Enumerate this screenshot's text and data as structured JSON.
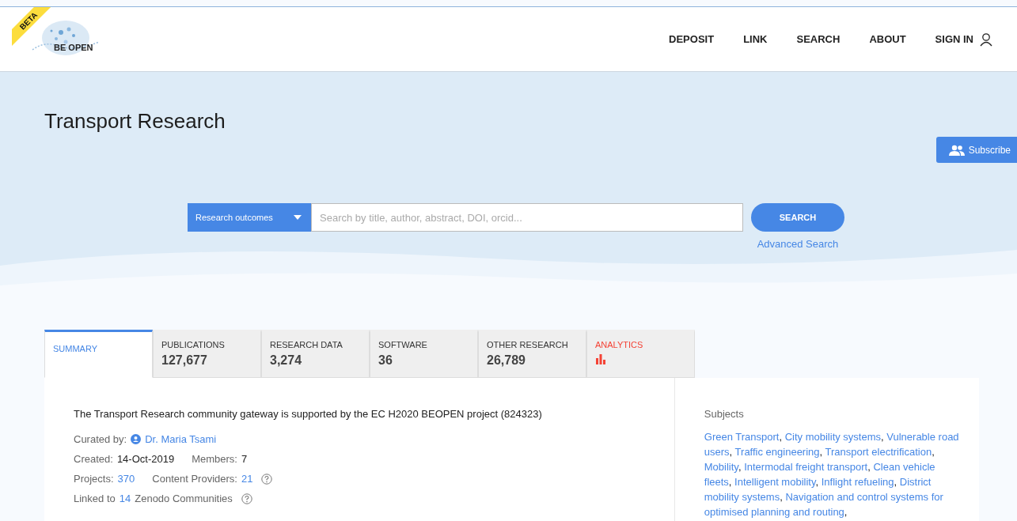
{
  "header": {
    "badge": "BETA",
    "logo_text": "BE OPEN",
    "nav": [
      {
        "label": "DEPOSIT"
      },
      {
        "label": "LINK"
      },
      {
        "label": "SEARCH"
      },
      {
        "label": "ABOUT"
      },
      {
        "label": "SIGN IN",
        "kind": "account"
      }
    ]
  },
  "hero": {
    "title": "Transport Research",
    "subscribe": "Subscribe",
    "search": {
      "dropdown": "Research outcomes",
      "placeholder": "Search by title, author, abstract, DOI, orcid...",
      "button": "SEARCH",
      "advanced": "Advanced Search"
    }
  },
  "tabs": [
    {
      "label": "SUMMARY",
      "selected": true,
      "kind": "plain"
    },
    {
      "label": "PUBLICATIONS",
      "count": "127,677",
      "selected": false,
      "kind": "count"
    },
    {
      "label": "RESEARCH DATA",
      "count": "3,274",
      "selected": false,
      "kind": "count"
    },
    {
      "label": "SOFTWARE",
      "count": "36",
      "selected": false,
      "kind": "count"
    },
    {
      "label": "OTHER RESEARCH",
      "count": "26,789",
      "selected": false,
      "kind": "count"
    },
    {
      "label": "ANALYTICS",
      "selected": false,
      "kind": "chart"
    }
  ],
  "summary": {
    "description": "The Transport Research community gateway is supported by the EC H2020 BEOPEN project (824323)",
    "lines": [
      [
        {
          "label": "Curated by:",
          "value": "Dr. Maria Tsami",
          "kind": "person"
        }
      ],
      [
        {
          "label": "Created:",
          "value": "14-Oct-2019",
          "kind": "plain"
        },
        {
          "label": "Members:",
          "value": "7",
          "kind": "plain"
        }
      ],
      [
        {
          "label": "Projects:",
          "value": "370",
          "kind": "link"
        },
        {
          "label": "Content Providers:",
          "value": "21",
          "kind": "link",
          "help": true
        }
      ],
      [
        {
          "label": "Linked to",
          "value": "14",
          "kind": "link",
          "suffix": "Zenodo Communities",
          "help": true
        }
      ]
    ]
  },
  "subjects": {
    "title": "Subjects",
    "separator": ",",
    "items": [
      "Green Transport",
      "City mobility systems",
      "Vulnerable road users",
      "Traffic engineering",
      "Transport electrification",
      "Mobility",
      "Intermodal freight transport",
      "Clean vehicle fleets",
      "Intelligent mobility",
      "Inflight refueling",
      "District mobility systems",
      "Navigation and control systems for optimised planning and routing"
    ]
  }
}
